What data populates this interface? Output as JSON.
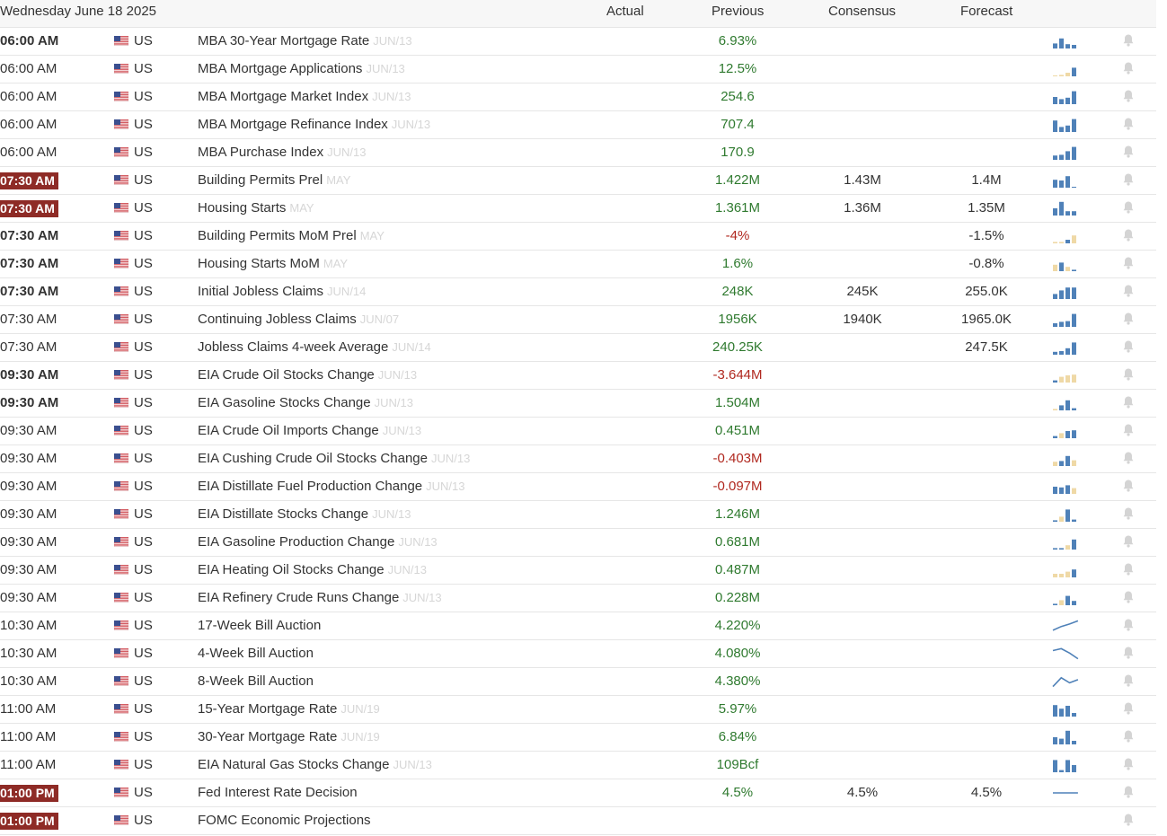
{
  "header": {
    "date": "Wednesday June 18 2025",
    "col_actual": "Actual",
    "col_previous": "Previous",
    "col_consensus": "Consensus",
    "col_forecast": "Forecast"
  },
  "colors": {
    "positive": "#2f7a2f",
    "negative": "#b0281f",
    "highlight": "#8e2b26",
    "spark_blue": "#4f81b8",
    "spark_tan": "#efd9a6",
    "bell": "#d4d4d4"
  },
  "icons": {
    "flag": "us-flag-icon",
    "bell": "bell-icon",
    "chart": "sparkline-icon"
  },
  "rows": [
    {
      "time": "06:00 AM",
      "style": "bold",
      "country": "US",
      "event": "MBA 30-Year Mortgage Rate",
      "ref": "JUN/13",
      "previous": "6.93%",
      "prev_dir": "pos",
      "consensus": "",
      "forecast": "",
      "spark": [
        {
          "h": 0.35,
          "c": "b"
        },
        {
          "h": 0.7,
          "c": "b"
        },
        {
          "h": 0.3,
          "c": "b"
        },
        {
          "h": 0.25,
          "c": "b"
        }
      ]
    },
    {
      "time": "06:00 AM",
      "style": "",
      "country": "US",
      "event": "MBA Mortgage Applications",
      "ref": "JUN/13",
      "previous": "12.5%",
      "prev_dir": "pos",
      "consensus": "",
      "forecast": "",
      "spark": [
        {
          "h": 0.05,
          "c": "t"
        },
        {
          "h": 0.1,
          "c": "t"
        },
        {
          "h": 0.25,
          "c": "t"
        },
        {
          "h": 0.6,
          "c": "b"
        }
      ]
    },
    {
      "time": "06:00 AM",
      "style": "",
      "country": "US",
      "event": "MBA Mortgage Market Index",
      "ref": "JUN/13",
      "previous": "254.6",
      "prev_dir": "pos",
      "consensus": "",
      "forecast": "",
      "spark": [
        {
          "h": 0.5,
          "c": "b"
        },
        {
          "h": 0.35,
          "c": "b"
        },
        {
          "h": 0.45,
          "c": "b"
        },
        {
          "h": 0.9,
          "c": "b"
        }
      ]
    },
    {
      "time": "06:00 AM",
      "style": "",
      "country": "US",
      "event": "MBA Mortgage Refinance Index",
      "ref": "JUN/13",
      "previous": "707.4",
      "prev_dir": "pos",
      "consensus": "",
      "forecast": "",
      "spark": [
        {
          "h": 0.8,
          "c": "b"
        },
        {
          "h": 0.35,
          "c": "b"
        },
        {
          "h": 0.45,
          "c": "b"
        },
        {
          "h": 0.9,
          "c": "b"
        }
      ]
    },
    {
      "time": "06:00 AM",
      "style": "",
      "country": "US",
      "event": "MBA Purchase Index",
      "ref": "JUN/13",
      "previous": "170.9",
      "prev_dir": "pos",
      "consensus": "",
      "forecast": "",
      "spark": [
        {
          "h": 0.3,
          "c": "b"
        },
        {
          "h": 0.35,
          "c": "b"
        },
        {
          "h": 0.6,
          "c": "b"
        },
        {
          "h": 0.9,
          "c": "b"
        }
      ]
    },
    {
      "time": "07:30 AM",
      "style": "hl",
      "country": "US",
      "event": "Building Permits Prel",
      "ref": "MAY",
      "previous": "1.422M",
      "prev_dir": "pos",
      "consensus": "1.43M",
      "forecast": "1.4M",
      "spark": [
        {
          "h": 0.55,
          "c": "b"
        },
        {
          "h": 0.5,
          "c": "b"
        },
        {
          "h": 0.8,
          "c": "b"
        },
        {
          "h": 0.05,
          "c": "b"
        }
      ]
    },
    {
      "time": "07:30 AM",
      "style": "hl",
      "country": "US",
      "event": "Housing Starts",
      "ref": "MAY",
      "previous": "1.361M",
      "prev_dir": "pos",
      "consensus": "1.36M",
      "forecast": "1.35M",
      "spark": [
        {
          "h": 0.5,
          "c": "b"
        },
        {
          "h": 0.95,
          "c": "b"
        },
        {
          "h": 0.3,
          "c": "b"
        },
        {
          "h": 0.3,
          "c": "b"
        }
      ]
    },
    {
      "time": "07:30 AM",
      "style": "bold",
      "country": "US",
      "event": "Building Permits MoM Prel",
      "ref": "MAY",
      "previous": "-4%",
      "prev_dir": "neg",
      "consensus": "",
      "forecast": "-1.5%",
      "spark": [
        {
          "h": 0.1,
          "c": "t"
        },
        {
          "h": 0.1,
          "c": "t"
        },
        {
          "h": 0.25,
          "c": "b"
        },
        {
          "h": 0.55,
          "c": "t"
        }
      ]
    },
    {
      "time": "07:30 AM",
      "style": "bold",
      "country": "US",
      "event": "Housing Starts MoM",
      "ref": "MAY",
      "previous": "1.6%",
      "prev_dir": "pos",
      "consensus": "",
      "forecast": "-0.8%",
      "spark": [
        {
          "h": 0.45,
          "c": "t"
        },
        {
          "h": 0.6,
          "c": "b"
        },
        {
          "h": 0.3,
          "c": "t"
        },
        {
          "h": 0.1,
          "c": "b"
        }
      ]
    },
    {
      "time": "07:30 AM",
      "style": "bold",
      "country": "US",
      "event": "Initial Jobless Claims",
      "ref": "JUN/14",
      "previous": "248K",
      "prev_dir": "pos",
      "consensus": "245K",
      "forecast": "255.0K",
      "spark": [
        {
          "h": 0.35,
          "c": "b"
        },
        {
          "h": 0.6,
          "c": "b"
        },
        {
          "h": 0.8,
          "c": "b"
        },
        {
          "h": 0.8,
          "c": "b"
        }
      ]
    },
    {
      "time": "07:30 AM",
      "style": "",
      "country": "US",
      "event": "Continuing Jobless Claims",
      "ref": "JUN/07",
      "previous": "1956K",
      "prev_dir": "pos",
      "consensus": "1940K",
      "forecast": "1965.0K",
      "spark": [
        {
          "h": 0.25,
          "c": "b"
        },
        {
          "h": 0.35,
          "c": "b"
        },
        {
          "h": 0.4,
          "c": "b"
        },
        {
          "h": 0.9,
          "c": "b"
        }
      ]
    },
    {
      "time": "07:30 AM",
      "style": "",
      "country": "US",
      "event": "Jobless Claims 4-week Average",
      "ref": "JUN/14",
      "previous": "240.25K",
      "prev_dir": "pos",
      "consensus": "",
      "forecast": "247.5K",
      "spark": [
        {
          "h": 0.2,
          "c": "b"
        },
        {
          "h": 0.25,
          "c": "b"
        },
        {
          "h": 0.45,
          "c": "b"
        },
        {
          "h": 0.85,
          "c": "b"
        }
      ]
    },
    {
      "time": "09:30 AM",
      "style": "bold",
      "country": "US",
      "event": "EIA Crude Oil Stocks Change",
      "ref": "JUN/13",
      "previous": "-3.644M",
      "prev_dir": "neg",
      "consensus": "",
      "forecast": "",
      "spark": [
        {
          "h": 0.15,
          "c": "b"
        },
        {
          "h": 0.4,
          "c": "t"
        },
        {
          "h": 0.5,
          "c": "t"
        },
        {
          "h": 0.55,
          "c": "t"
        }
      ]
    },
    {
      "time": "09:30 AM",
      "style": "bold",
      "country": "US",
      "event": "EIA Gasoline Stocks Change",
      "ref": "JUN/13",
      "previous": "1.504M",
      "prev_dir": "pos",
      "consensus": "",
      "forecast": "",
      "spark": [
        {
          "h": 0.1,
          "c": "t"
        },
        {
          "h": 0.35,
          "c": "b"
        },
        {
          "h": 0.7,
          "c": "b"
        },
        {
          "h": 0.15,
          "c": "b"
        }
      ]
    },
    {
      "time": "09:30 AM",
      "style": "",
      "country": "US",
      "event": "EIA Crude Oil Imports Change",
      "ref": "JUN/13",
      "previous": "0.451M",
      "prev_dir": "pos",
      "consensus": "",
      "forecast": "",
      "spark": [
        {
          "h": 0.15,
          "c": "b"
        },
        {
          "h": 0.35,
          "c": "t"
        },
        {
          "h": 0.5,
          "c": "b"
        },
        {
          "h": 0.55,
          "c": "b"
        }
      ]
    },
    {
      "time": "09:30 AM",
      "style": "",
      "country": "US",
      "event": "EIA Cushing Crude Oil Stocks Change",
      "ref": "JUN/13",
      "previous": "-0.403M",
      "prev_dir": "neg",
      "consensus": "",
      "forecast": "",
      "spark": [
        {
          "h": 0.3,
          "c": "t"
        },
        {
          "h": 0.35,
          "c": "b"
        },
        {
          "h": 0.7,
          "c": "b"
        },
        {
          "h": 0.4,
          "c": "t"
        }
      ]
    },
    {
      "time": "09:30 AM",
      "style": "",
      "country": "US",
      "event": "EIA Distillate Fuel Production Change",
      "ref": "JUN/13",
      "previous": "-0.097M",
      "prev_dir": "neg",
      "consensus": "",
      "forecast": "",
      "spark": [
        {
          "h": 0.5,
          "c": "b"
        },
        {
          "h": 0.45,
          "c": "b"
        },
        {
          "h": 0.6,
          "c": "b"
        },
        {
          "h": 0.4,
          "c": "t"
        }
      ]
    },
    {
      "time": "09:30 AM",
      "style": "",
      "country": "US",
      "event": "EIA Distillate Stocks Change",
      "ref": "JUN/13",
      "previous": "1.246M",
      "prev_dir": "pos",
      "consensus": "",
      "forecast": "",
      "spark": [
        {
          "h": 0.1,
          "c": "b"
        },
        {
          "h": 0.35,
          "c": "t"
        },
        {
          "h": 0.85,
          "c": "b"
        },
        {
          "h": 0.15,
          "c": "b"
        }
      ]
    },
    {
      "time": "09:30 AM",
      "style": "",
      "country": "US",
      "event": "EIA Gasoline Production Change",
      "ref": "JUN/13",
      "previous": "0.681M",
      "prev_dir": "pos",
      "consensus": "",
      "forecast": "",
      "spark": [
        {
          "h": 0.1,
          "c": "b"
        },
        {
          "h": 0.1,
          "c": "b"
        },
        {
          "h": 0.3,
          "c": "t"
        },
        {
          "h": 0.7,
          "c": "b"
        }
      ]
    },
    {
      "time": "09:30 AM",
      "style": "",
      "country": "US",
      "event": "EIA Heating Oil Stocks Change",
      "ref": "JUN/13",
      "previous": "0.487M",
      "prev_dir": "pos",
      "consensus": "",
      "forecast": "",
      "spark": [
        {
          "h": 0.25,
          "c": "t"
        },
        {
          "h": 0.25,
          "c": "t"
        },
        {
          "h": 0.4,
          "c": "t"
        },
        {
          "h": 0.55,
          "c": "b"
        }
      ]
    },
    {
      "time": "09:30 AM",
      "style": "",
      "country": "US",
      "event": "EIA Refinery Crude Runs Change",
      "ref": "JUN/13",
      "previous": "0.228M",
      "prev_dir": "pos",
      "consensus": "",
      "forecast": "",
      "spark": [
        {
          "h": 0.1,
          "c": "b"
        },
        {
          "h": 0.35,
          "c": "t"
        },
        {
          "h": 0.65,
          "c": "b"
        },
        {
          "h": 0.3,
          "c": "b"
        }
      ]
    },
    {
      "time": "10:30 AM",
      "style": "",
      "country": "US",
      "event": "17-Week Bill Auction",
      "ref": "",
      "previous": "4.220%",
      "prev_dir": "pos",
      "consensus": "",
      "forecast": "",
      "line": [
        0.85,
        0.55,
        0.35,
        0.1
      ]
    },
    {
      "time": "10:30 AM",
      "style": "",
      "country": "US",
      "event": "4-Week Bill Auction",
      "ref": "",
      "previous": "4.080%",
      "prev_dir": "pos",
      "consensus": "",
      "forecast": "",
      "line": [
        0.25,
        0.1,
        0.45,
        0.9
      ]
    },
    {
      "time": "10:30 AM",
      "style": "",
      "country": "US",
      "event": "8-Week Bill Auction",
      "ref": "",
      "previous": "4.380%",
      "prev_dir": "pos",
      "consensus": "",
      "forecast": "",
      "line": [
        0.9,
        0.2,
        0.6,
        0.35
      ]
    },
    {
      "time": "11:00 AM",
      "style": "",
      "country": "US",
      "event": "15-Year Mortgage Rate",
      "ref": "JUN/19",
      "previous": "5.97%",
      "prev_dir": "pos",
      "consensus": "",
      "forecast": "",
      "spark": [
        {
          "h": 0.8,
          "c": "b"
        },
        {
          "h": 0.55,
          "c": "b"
        },
        {
          "h": 0.75,
          "c": "b"
        },
        {
          "h": 0.25,
          "c": "b"
        }
      ]
    },
    {
      "time": "11:00 AM",
      "style": "",
      "country": "US",
      "event": "30-Year Mortgage Rate",
      "ref": "JUN/19",
      "previous": "6.84%",
      "prev_dir": "pos",
      "consensus": "",
      "forecast": "",
      "spark": [
        {
          "h": 0.5,
          "c": "b"
        },
        {
          "h": 0.4,
          "c": "b"
        },
        {
          "h": 0.95,
          "c": "b"
        },
        {
          "h": 0.25,
          "c": "b"
        }
      ]
    },
    {
      "time": "11:00 AM",
      "style": "",
      "country": "US",
      "event": "EIA Natural Gas Stocks Change",
      "ref": "JUN/13",
      "previous": "109Bcf",
      "prev_dir": "pos",
      "consensus": "",
      "forecast": "",
      "spark": [
        {
          "h": 0.85,
          "c": "b"
        },
        {
          "h": 0.15,
          "c": "b"
        },
        {
          "h": 0.85,
          "c": "b"
        },
        {
          "h": 0.5,
          "c": "b"
        }
      ]
    },
    {
      "time": "01:00 PM",
      "style": "hl",
      "country": "US",
      "event": "Fed Interest Rate Decision",
      "ref": "",
      "previous": "4.5%",
      "prev_dir": "pos",
      "consensus": "4.5%",
      "forecast": "4.5%",
      "line": [
        0.5,
        0.5,
        0.5,
        0.5
      ]
    },
    {
      "time": "01:00 PM",
      "style": "hl",
      "country": "US",
      "event": "FOMC Economic Projections",
      "ref": "",
      "previous": "",
      "prev_dir": "pos",
      "consensus": "",
      "forecast": ""
    }
  ]
}
